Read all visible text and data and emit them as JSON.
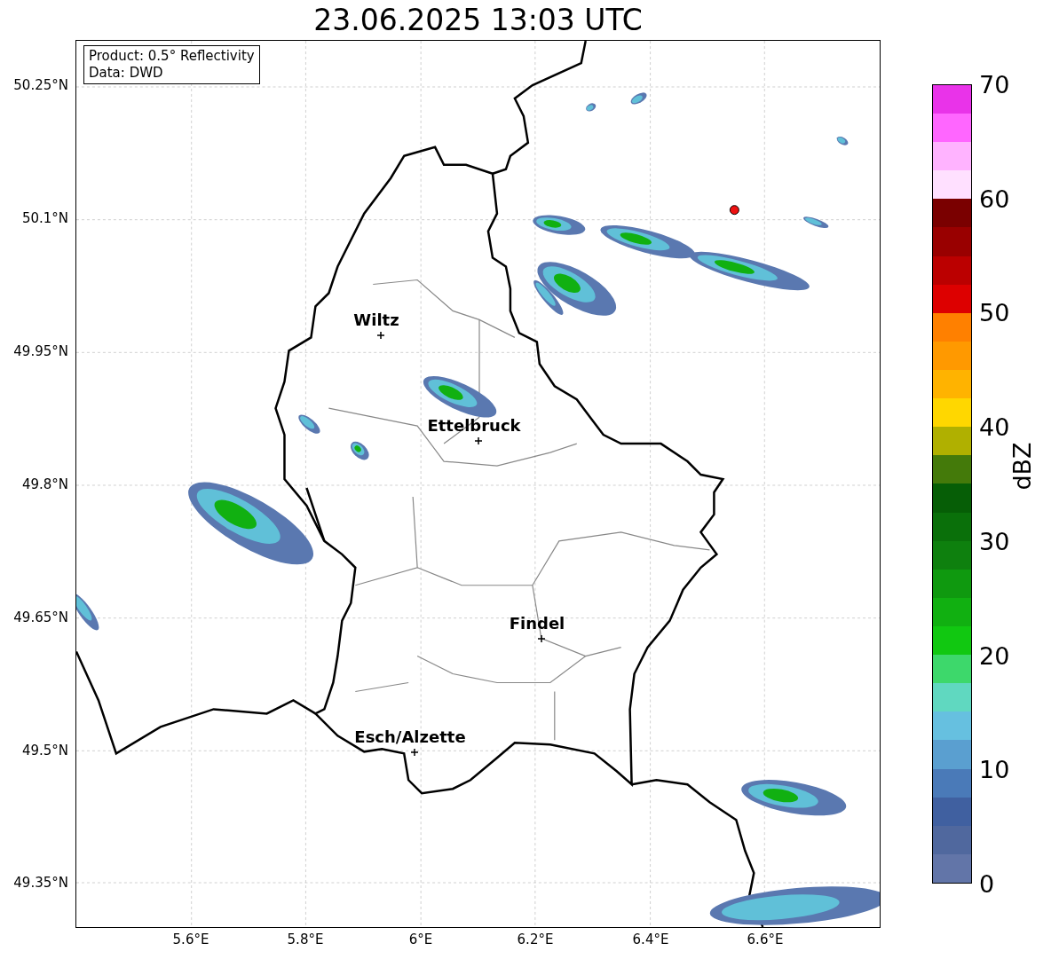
{
  "title": "23.06.2025 13:03 UTC",
  "info": [
    "Product: 0.5° Reflectivity",
    "Data: DWD"
  ],
  "lat_ticks": [
    "50.25°N",
    "50.1°N",
    "49.95°N",
    "49.8°N",
    "49.65°N",
    "49.5°N",
    "49.35°N"
  ],
  "lon_ticks": [
    "5.6°E",
    "5.8°E",
    "6°E",
    "6.2°E",
    "6.4°E",
    "6.6°E"
  ],
  "cities": [
    {
      "name": "Wiltz"
    },
    {
      "name": "Ettelbruck"
    },
    {
      "name": "Findel"
    },
    {
      "name": "Esch/Alzette"
    }
  ],
  "colorbar": {
    "label": "dBZ",
    "ticks": [
      "70",
      "60",
      "50",
      "40",
      "30",
      "20",
      "10",
      "0"
    ],
    "segments": [
      {
        "color": "#6275a8"
      },
      {
        "color": "#50689e"
      },
      {
        "color": "#4060a0"
      },
      {
        "color": "#4a7ab8"
      },
      {
        "color": "#5a9fd0"
      },
      {
        "color": "#66c0e0"
      },
      {
        "color": "#60d8c0"
      },
      {
        "color": "#3dd86b"
      },
      {
        "color": "#11c811"
      },
      {
        "color": "#11b011"
      },
      {
        "color": "#0f990f"
      },
      {
        "color": "#0e800e"
      },
      {
        "color": "#0a700a"
      },
      {
        "color": "#065e06"
      },
      {
        "color": "#447a0a"
      },
      {
        "color": "#b0b000"
      },
      {
        "color": "#ffd700"
      },
      {
        "color": "#ffb300"
      },
      {
        "color": "#ff9900"
      },
      {
        "color": "#ff8000"
      },
      {
        "color": "#dd0000"
      },
      {
        "color": "#bb0000"
      },
      {
        "color": "#990000"
      },
      {
        "color": "#7a0000"
      },
      {
        "color": "#ffe0ff"
      },
      {
        "color": "#ffb3ff"
      },
      {
        "color": "#ff66ff"
      },
      {
        "color": "#e933e9"
      }
    ]
  }
}
